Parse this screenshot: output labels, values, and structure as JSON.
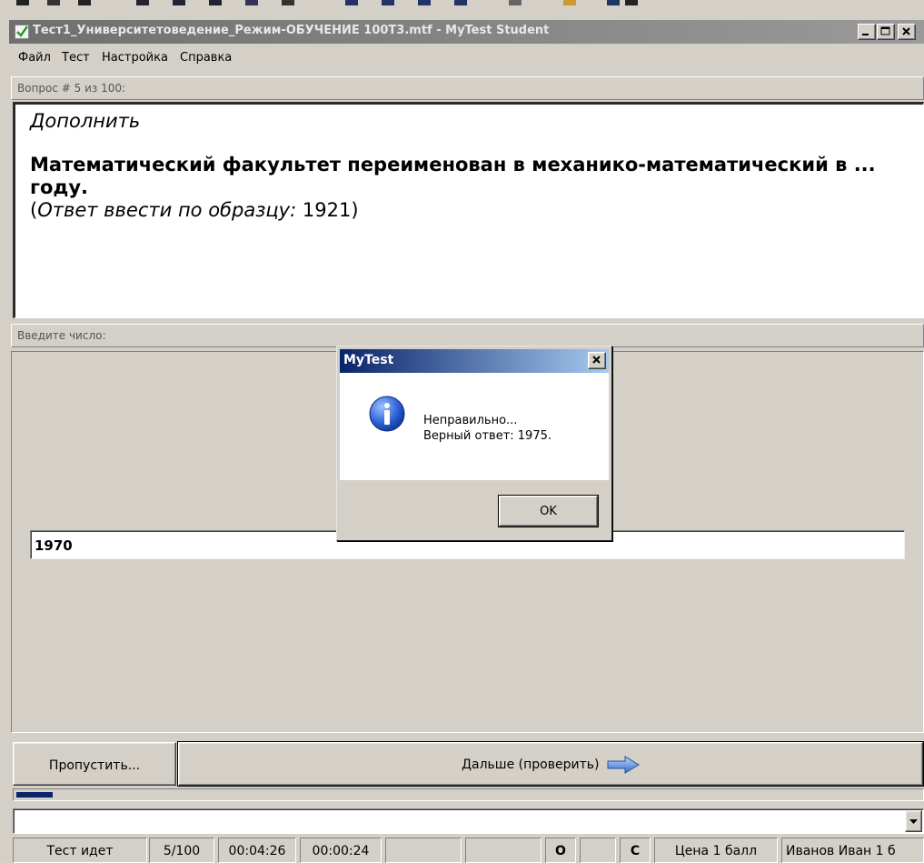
{
  "window": {
    "title": "Тест1_Университетоведение_Режим-ОБУЧЕНИЕ 100Т3.mtf - MyTest Student",
    "minimize_label": "_",
    "maximize_label": "□",
    "close_label": "✕"
  },
  "menu": {
    "items": [
      "Файл",
      "Тест",
      "Настройка",
      "Справка"
    ]
  },
  "question": {
    "header": "Вопрос # 5 из 100:",
    "type": "Дополнить",
    "text": "Математический факультет переименован в механико-математический в ... году.",
    "hint_label": "Ответ ввести по образцу:",
    "hint_example": "1921",
    "hint_open": "(",
    "hint_close": ")"
  },
  "answer": {
    "header": "Введите число:",
    "value": "1970"
  },
  "buttons": {
    "skip": "Пропустить...",
    "next": "Дальше (проверить)"
  },
  "progress": {
    "fraction": 0.05
  },
  "combo": {
    "value": "",
    "arrow": "▼"
  },
  "status": {
    "state": "Тест идет",
    "count": "5/100",
    "elapsed": "00:04:26",
    "question_time": "00:00:24",
    "empty1": "",
    "empty2": "",
    "o_flag": "O",
    "empty3": "",
    "c_flag": "C",
    "price": "Цена 1 балл",
    "user": "Иванов Иван 1 б"
  },
  "dialog": {
    "title": "MyTest",
    "close": "✕",
    "line1": "Неправильно...",
    "line2": "Верный ответ: 1975.",
    "ok": "OK"
  },
  "colors": {
    "title_active_start": "#0a246a",
    "title_active_end": "#a6caf0",
    "face": "#d4d0c8"
  }
}
